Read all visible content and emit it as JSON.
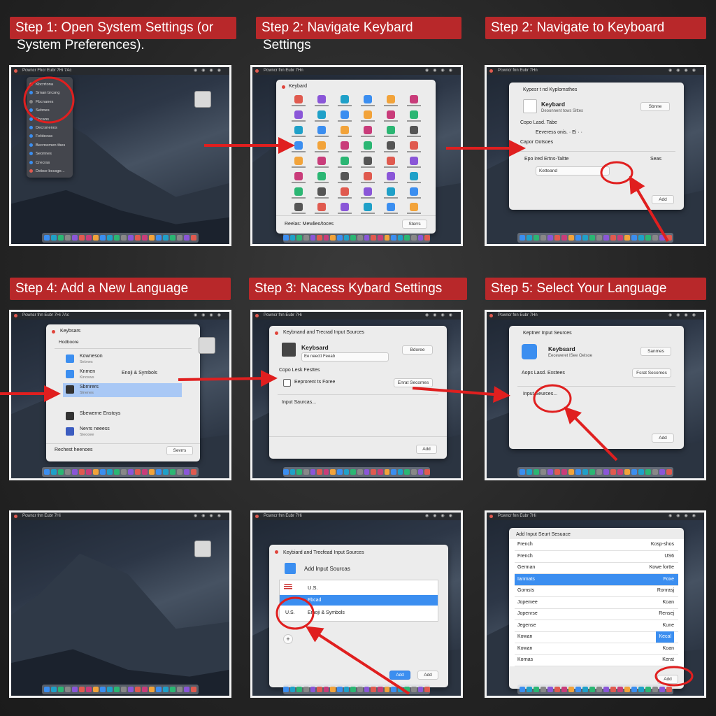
{
  "captions": {
    "c1_line1": "Step 1: Open System Settings (or",
    "c1_line2": "System Preferences).",
    "c2_line1": "Step 2: Navigate Keybard",
    "c2_line2": "Settings",
    "c3": "Step 2: Navigate to Keyboard",
    "c4": "Step 4: Add a New Language",
    "c5": "Step 3: Nacess Kybard Settings",
    "c6": "Step 5: Select Your Language"
  },
  "menubar": {
    "p1": "Pcwncr Fhcr Eubr 7Hi 7Ac",
    "p2": "Pcwncr fnn Eubr 7Hn",
    "p3": "Pcwncr fnn Eubr 7Hn",
    "p4": "Pcwncr fnn Eubr 7Hi 7Ac",
    "p5": "Pcwncr fnn Eubr 7Hi",
    "p6": "Pcwncr fnn Eubr 7Hn",
    "p7": "Pcwncr fnn Eubr 7Hi",
    "p8": "Pcwncr fnn Eubr 7Hi",
    "p9": "Pcwncr fnn Eubr 7Hi"
  },
  "p1": {
    "menu_items": [
      "Kbcrrtona",
      "Srnan brcsng",
      "Fbcnanes",
      "Sebnes",
      "Fbcans",
      "Decrsnenos",
      "Febbcras",
      "Becrnemen tbes",
      "Seonnes",
      "Crecras",
      "Debce bccsge..."
    ]
  },
  "p2": {
    "title": "Keybard",
    "footer_label": "Reelas: Mewlieo/toces",
    "footer_button": "Sterrs"
  },
  "p3": {
    "title": "Kypesr t nd Kyplomsthes",
    "section_title": "Keybard",
    "section_sub": "Deoonnent tows Sittes",
    "section_button": "Sbnne",
    "row1": "Copo Lasd. Tabe",
    "row2": "Eeveress onis. · Ei · ·",
    "row3": "Capor Ootsoes",
    "row4_label": "Epo ired Ertns-Taltte",
    "row4_right": "Seas",
    "field": "Ketteand",
    "add_button": "Add"
  },
  "p4": {
    "title": "Keybsars",
    "subtitle": "Hodboore",
    "items": [
      {
        "label": "Kowneson",
        "sub": "Sebnes"
      },
      {
        "label": "Knmen",
        "sub": "Kinosws"
      },
      {
        "label": "Sbrnrers",
        "sub": "Slnenes"
      },
      {
        "label": "Sbewerne Enstoys",
        "sub": ""
      },
      {
        "label": "Nevrs neeess",
        "sub": "Steooee"
      }
    ],
    "emoji_label": "Enoji & Symbols",
    "footer_label": "Rechest heenoes",
    "footer_button": "Sevrrs"
  },
  "p5": {
    "title": "Keybnand and Trecrad Input Sources",
    "section_title": "Keybsard",
    "section_sub": "Ee neectt Feeab",
    "section_button": "Bdoree",
    "row1": "Copo Lesk Festtes",
    "row2": "Eeprorent ts Foree",
    "row2_button": "Enrat Secomes",
    "row3": "Input Saurcas...",
    "add_button": "Add"
  },
  "p6": {
    "title": "Keptner Input Seurces",
    "section_title": "Keybsard",
    "section_sub": "Eeceweret ISee Oelsoe",
    "section_button": "Sanmes",
    "row1": "Aops Lasd. Exstees",
    "row1_button": "Fsrat Secomes",
    "row2": "Input Seurces...",
    "add_button": "Add"
  },
  "p8": {
    "title": "Keybiard and Trecfead Input Sources",
    "subtitle": "Add Input Sourcas",
    "items": [
      {
        "label": "U.S."
      },
      {
        "label": "Fbcad"
      },
      {
        "label": "Emoji & Symbols"
      }
    ],
    "us_small": "U.S.",
    "plus": "+",
    "add_button": "Add",
    "add_button2": "Add"
  },
  "p9": {
    "title": "Add Input Seurt Sesuace",
    "rows": [
      {
        "l": "French",
        "r": "Kosp-shos"
      },
      {
        "l": "French",
        "r": "US6"
      },
      {
        "l": "German",
        "r": "Kowe fortte"
      },
      {
        "l": "Ianmats",
        "r": "Foxe"
      },
      {
        "l": "Gomsts",
        "r": "Ronrasj"
      },
      {
        "l": "Jopemee",
        "r": "Koan"
      },
      {
        "l": "Jopenrse",
        "r": "Rensej"
      },
      {
        "l": "Jegense",
        "r": "Kune"
      },
      {
        "l": "Kowan",
        "r": "Kecal"
      },
      {
        "l": "Kowan",
        "r": "Koan"
      },
      {
        "l": "Kornas",
        "r": "Kerat"
      }
    ],
    "add_button": "Add"
  },
  "colors": {
    "accent": "#b8282a",
    "arrow": "#e01f1f",
    "select": "#3b8ef0"
  }
}
